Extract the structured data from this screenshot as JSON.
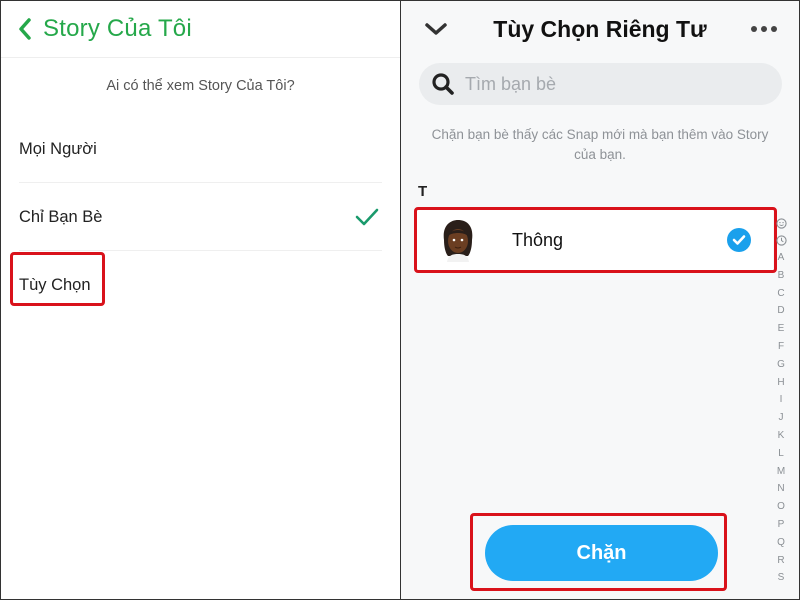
{
  "left_screen": {
    "header": {
      "title": "Story Của Tôi",
      "back_icon": "chevron-left-icon"
    },
    "subtitle": "Ai có thể xem Story Của Tôi?",
    "options": [
      {
        "label": "Mọi Người",
        "selected": false
      },
      {
        "label": "Chỉ Bạn Bè",
        "selected": true
      },
      {
        "label": "Tùy Chọn",
        "selected": false,
        "highlighted": true
      }
    ],
    "accent_color": "#25a84a"
  },
  "right_screen": {
    "header": {
      "title": "Tùy Chọn Riêng Tư",
      "collapse_icon": "chevron-down-icon",
      "more_icon": "more-dots-icon"
    },
    "search": {
      "placeholder": "Tìm bạn bè",
      "value": "",
      "icon": "search-icon"
    },
    "description": "Chặn bạn bè thấy các Snap mới mà bạn thêm vào Story của bạn.",
    "section_letter": "T",
    "friends": [
      {
        "name": "Thông",
        "selected": true,
        "highlighted": true
      }
    ],
    "index": [
      "A",
      "B",
      "C",
      "D",
      "E",
      "F",
      "G",
      "H",
      "I",
      "J",
      "K",
      "L",
      "M",
      "N",
      "O",
      "P",
      "Q",
      "R",
      "S"
    ],
    "action_button": {
      "label": "Chặn",
      "highlighted": true
    },
    "accent_color": "#22a9f4",
    "highlight_color": "#d9121b"
  }
}
